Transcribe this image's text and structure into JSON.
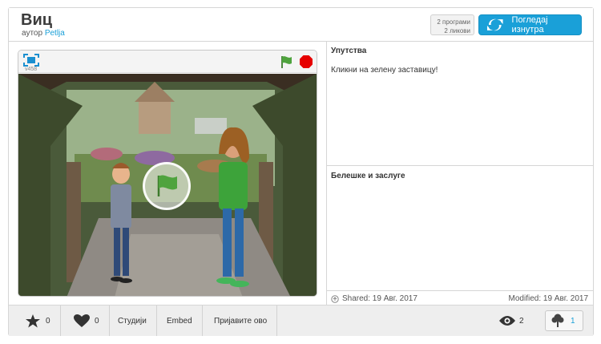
{
  "project": {
    "title": "Виц",
    "author_prefix": "аутор",
    "author": "Petlja",
    "scripts_count": "2 програми",
    "sprites_count": "2 ликови",
    "see_inside_label": "Погледај изнутра"
  },
  "player": {
    "version": "v458"
  },
  "side": {
    "instructions_title": "Упутства",
    "instructions_text": "Кликни на зелену заставицу!",
    "notes_title": "Белешке и заслуге",
    "notes_text": "",
    "shared": "Shared: 19 Авг. 2017",
    "modified": "Modified: 19 Авг. 2017"
  },
  "footer": {
    "loves_count": "0",
    "favorites_count": "0",
    "studios_label": "Студији",
    "embed_label": "Embed",
    "report_label": "Пријавите ово",
    "views_count": "2",
    "remix_count": "1"
  },
  "colors": {
    "accent": "#1aa0d8",
    "flag_green": "#4fa33e",
    "stop_red": "#e60000"
  },
  "icons": [
    "fullscreen-icon",
    "green-flag-icon",
    "stop-icon",
    "star-icon",
    "heart-icon",
    "eye-icon",
    "remix-tree-icon",
    "see-inside-icon",
    "share-icon"
  ]
}
